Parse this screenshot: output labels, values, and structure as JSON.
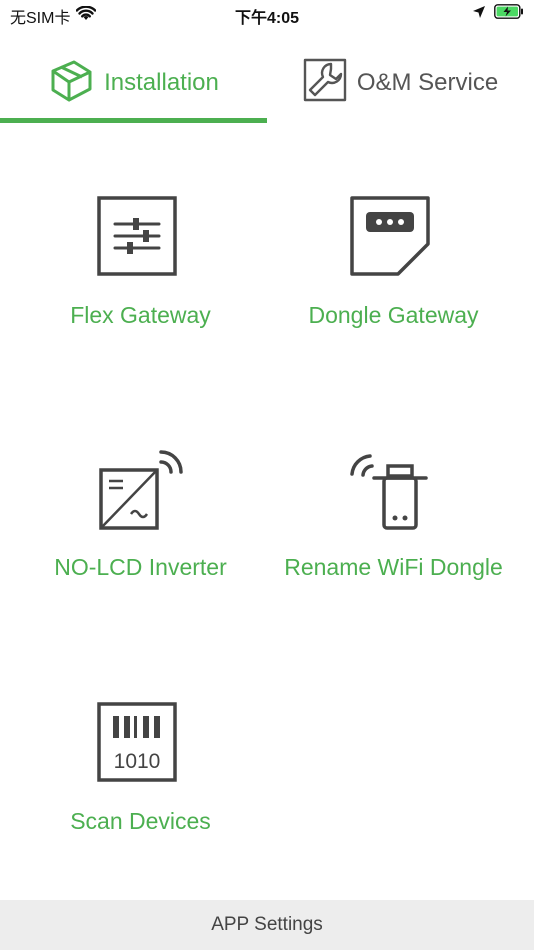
{
  "status_bar": {
    "carrier": "无SIM卡",
    "time": "下午4:05"
  },
  "tabs": [
    {
      "label": "Installation",
      "icon": "package-box-icon",
      "active": true
    },
    {
      "label": "O&M Service",
      "icon": "wrench-icon",
      "active": false
    }
  ],
  "tiles": [
    {
      "label": "Flex Gateway",
      "icon": "sliders-icon"
    },
    {
      "label": "Dongle Gateway",
      "icon": "dongle-card-icon"
    },
    {
      "label": "NO-LCD Inverter",
      "icon": "inverter-wireless-icon"
    },
    {
      "label": "Rename WiFi Dongle",
      "icon": "wifi-dongle-icon"
    },
    {
      "label": "Scan Devices",
      "icon": "barcode-scan-icon"
    }
  ],
  "scan_icon_text": "1010",
  "footer": {
    "label": "APP Settings"
  },
  "colors": {
    "accent": "#4caf50",
    "icon_gray": "#444444",
    "footer_bg": "#ededed"
  }
}
